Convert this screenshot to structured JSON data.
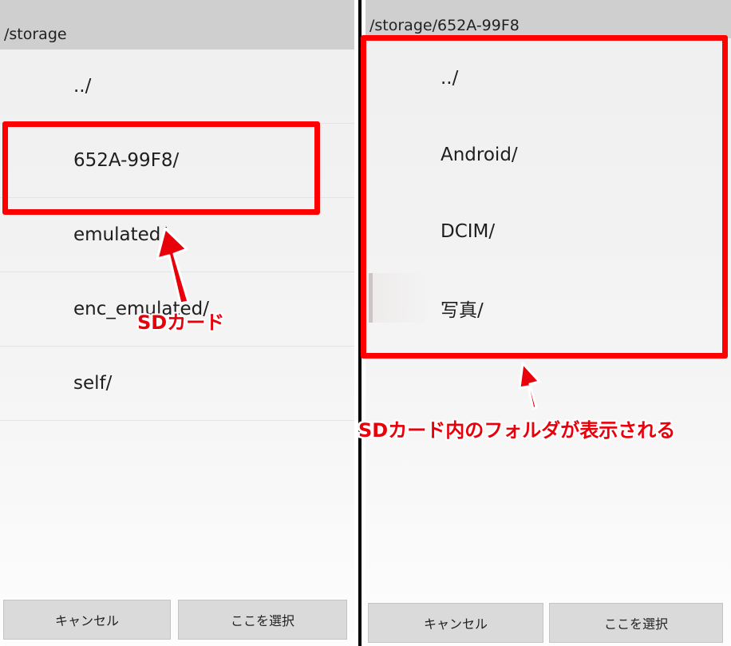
{
  "left_screen": {
    "path": "/storage",
    "items": [
      "../",
      "652A-99F8/",
      "emulated/",
      "enc_emulated/",
      "self/"
    ],
    "cancel_label": "キャンセル",
    "select_label": "ここを選択"
  },
  "right_screen": {
    "path": "/storage/652A-99F8",
    "items": [
      "../",
      "Android/",
      "DCIM/",
      "写真/"
    ],
    "cancel_label": "キャンセル",
    "select_label": "ここを選択"
  },
  "annotations": {
    "left_label": "SDカード",
    "right_label": "SDカード内のフォルダが表示される"
  },
  "colors": {
    "highlight": "#ff0000",
    "annotation_text": "#e8000b",
    "header_bg": "#cfcfcf",
    "button_bg": "#dadada"
  }
}
